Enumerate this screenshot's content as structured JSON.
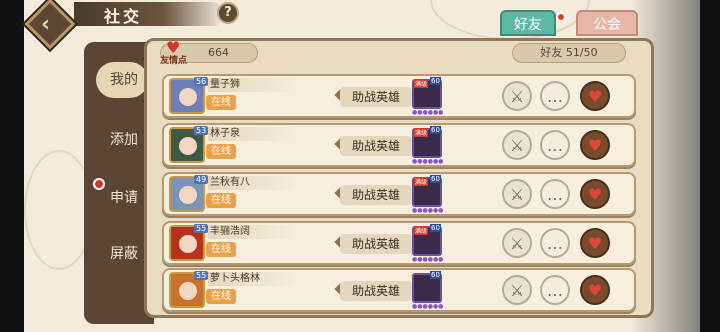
{
  "header": {
    "title": "社交",
    "help": "?"
  },
  "tabs": [
    {
      "label": "好友"
    },
    {
      "label": "公会"
    }
  ],
  "nav": [
    {
      "label": "我的"
    },
    {
      "label": "添加"
    },
    {
      "label": "申请"
    },
    {
      "label": "屏蔽"
    }
  ],
  "friend_points": {
    "label": "友情点",
    "value": "664"
  },
  "friend_count": {
    "text": "好友  51/50"
  },
  "rows": [
    {
      "name": "量子狮",
      "level": "56",
      "status": "在线",
      "help_label": "助战英雄",
      "hero_level": "60",
      "hero_tag": "满级",
      "avatar_bg": "#6f7fb8"
    },
    {
      "name": "林子泉",
      "level": "53",
      "status": "在线",
      "help_label": "助战英雄",
      "hero_level": "60",
      "hero_tag": "满级",
      "avatar_bg": "#3c5a46"
    },
    {
      "name": "兰秋有八",
      "level": "49",
      "status": "在线",
      "help_label": "助战英雄",
      "hero_level": "60",
      "hero_tag": "满级",
      "avatar_bg": "#7a95b7"
    },
    {
      "name": "丰骊浩阔",
      "level": "55",
      "status": "在线",
      "help_label": "助战英雄",
      "hero_level": "60",
      "hero_tag": "满级",
      "avatar_bg": "#b3331f"
    },
    {
      "name": "萝卜头格林",
      "level": "55",
      "status": "在线",
      "help_label": "助战英雄",
      "hero_level": "60",
      "hero_tag": "",
      "avatar_bg": "#c8722d"
    }
  ]
}
